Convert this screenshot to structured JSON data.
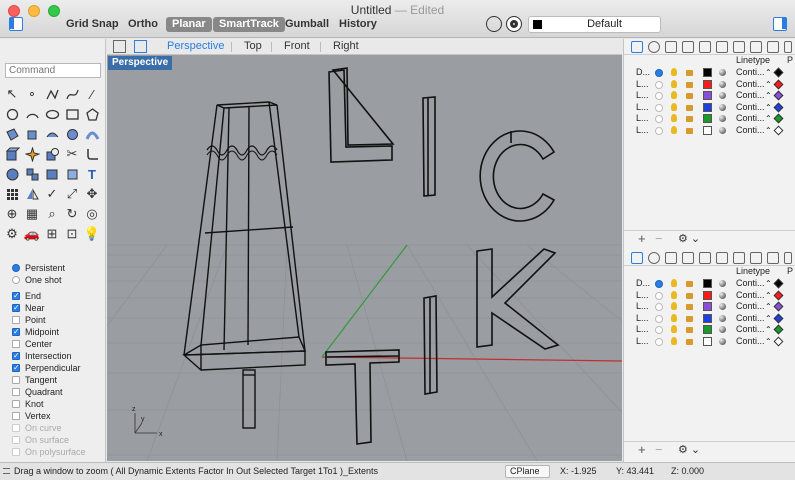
{
  "window": {
    "title": "Untitled",
    "edited": "— Edited"
  },
  "toolbar": {
    "grid_snap": "Grid Snap",
    "ortho": "Ortho",
    "planar": "Planar",
    "smarttrack": "SmartTrack",
    "gumball": "Gumball",
    "history": "History",
    "current_layer": "Default"
  },
  "command": {
    "placeholder": "Command"
  },
  "viewport": {
    "tabs": [
      "Perspective",
      "Top",
      "Front",
      "Right"
    ],
    "active_label": "Perspective"
  },
  "osnaps": {
    "persistent": "Persistent",
    "one_shot": "One shot",
    "items": [
      {
        "label": "End",
        "on": true
      },
      {
        "label": "Near",
        "on": true
      },
      {
        "label": "Point",
        "on": false
      },
      {
        "label": "Midpoint",
        "on": true
      },
      {
        "label": "Center",
        "on": false
      },
      {
        "label": "Intersection",
        "on": true
      },
      {
        "label": "Perpendicular",
        "on": true
      },
      {
        "label": "Tangent",
        "on": false
      },
      {
        "label": "Quadrant",
        "on": false
      },
      {
        "label": "Knot",
        "on": false
      },
      {
        "label": "Vertex",
        "on": false
      }
    ],
    "disabled": [
      "On curve",
      "On surface",
      "On polysurface"
    ]
  },
  "layers": {
    "linetype_header": "Linetype",
    "print_header": "P",
    "rows": [
      {
        "name": "D...",
        "current": true,
        "color": "#000000",
        "linetype": "Conti...",
        "print_color": "#000000"
      },
      {
        "name": "L...",
        "current": false,
        "color": "#ff1a1a",
        "linetype": "Conti...",
        "print_color": "#ff1a1a"
      },
      {
        "name": "L...",
        "current": false,
        "color": "#8a4fd8",
        "linetype": "Conti...",
        "print_color": "#8a4fd8"
      },
      {
        "name": "L...",
        "current": false,
        "color": "#1f3fe0",
        "linetype": "Conti...",
        "print_color": "#1f3fe0"
      },
      {
        "name": "L...",
        "current": false,
        "color": "#1a9a2a",
        "linetype": "Conti...",
        "print_color": "#1a9a2a"
      },
      {
        "name": "L...",
        "current": false,
        "color": "#ffffff",
        "linetype": "Conti...",
        "print_color": "#ffffff"
      }
    ]
  },
  "status": {
    "message": "Drag a window to zoom ( All Dynamic Extents Factor In Out Selected Target 1To1 )_Extents",
    "cplane": "CPlane",
    "x": "X: -1.925",
    "y": "Y: 43.441",
    "z": "Z: 0.000"
  },
  "colors": {
    "accent": "#2a7de1",
    "viewport_bg": "#9a9da2",
    "viewport_label": "#3b6ea8"
  }
}
